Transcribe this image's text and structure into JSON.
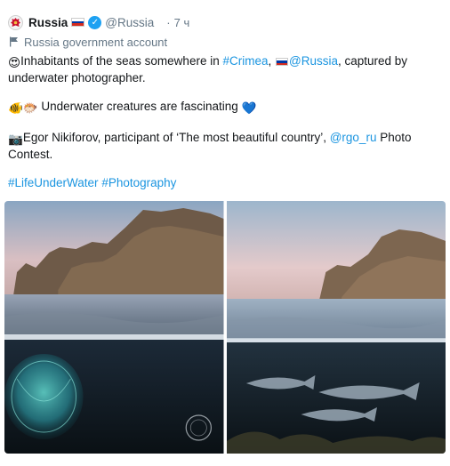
{
  "tweet": {
    "display_name": "Russia",
    "handle": "@Russia",
    "time": "7 ч",
    "separator": "·",
    "account_label": "Russia government account",
    "line1_pre": "Inhabitants of the seas somewhere in ",
    "hashtag_crimea": "#Crimea",
    "line1_mid": ", ",
    "mention_russia": "@Russia",
    "line1_post": ", captured by underwater photographer.",
    "line2": " Underwater creatures are fascinating ",
    "line3_pre": "Egor Nikiforov, participant of ‘The most beautiful country’, ",
    "mention_rgo": "@rgo_ru",
    "line3_post": " Photo Contest.",
    "hashtag_life": "#LifeUnderWater",
    "hashtag_photo": "#Photography",
    "hashtag_space": " "
  },
  "icons": {
    "verified": "✓",
    "heart_eyes": "😍",
    "fish": "🐠",
    "blowfish": "🐡",
    "blue_heart": "💙",
    "camera": "📷"
  },
  "colors": {
    "link": "#1b95e0",
    "verified": "#1da1f2",
    "secondary_text": "#657786"
  },
  "media": [
    {
      "label": "photo-1"
    },
    {
      "label": "photo-2"
    }
  ]
}
